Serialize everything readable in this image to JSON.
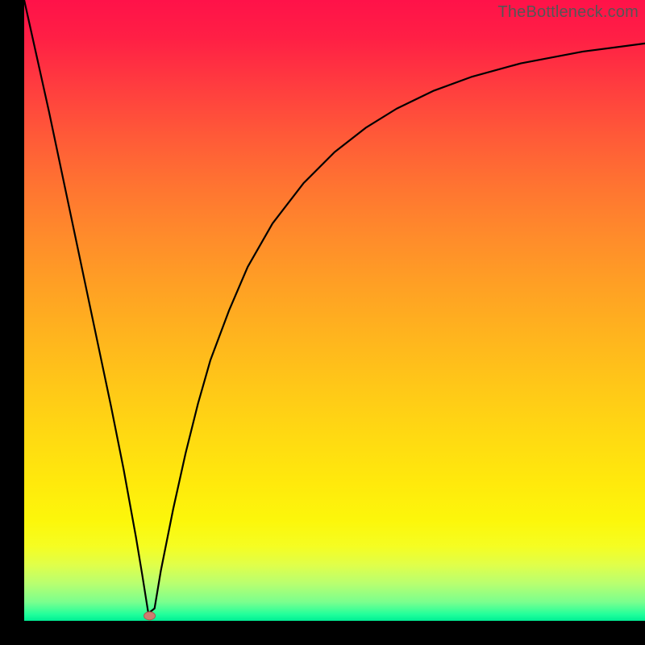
{
  "watermark": "TheBottleneck.com",
  "colors": {
    "frame": "#000000",
    "curve": "#000000",
    "marker_fill": "#cf7b70",
    "marker_stroke": "#a85a4f",
    "gradient_top": "#ff1249",
    "gradient_bottom": "#00ed94"
  },
  "chart_data": {
    "type": "line",
    "title": "",
    "xlabel": "",
    "ylabel": "",
    "xlim": [
      0,
      100
    ],
    "ylim": [
      0,
      100
    ],
    "grid": false,
    "x": [
      0,
      2,
      4,
      6,
      8,
      10,
      12,
      14,
      16,
      18,
      19,
      20,
      21,
      22,
      24,
      26,
      28,
      30,
      33,
      36,
      40,
      45,
      50,
      55,
      60,
      66,
      72,
      80,
      90,
      100
    ],
    "values": [
      100,
      91,
      82,
      72.5,
      63,
      53.5,
      44,
      34.5,
      24.5,
      13.5,
      7.5,
      1.2,
      2,
      8,
      18,
      27,
      35,
      42,
      50,
      57,
      64,
      70.5,
      75.5,
      79.4,
      82.5,
      85.4,
      87.6,
      89.8,
      91.7,
      93
    ],
    "marker": {
      "x": 20.2,
      "y": 0.8
    },
    "annotations": []
  }
}
